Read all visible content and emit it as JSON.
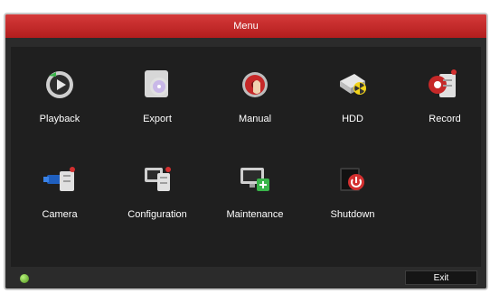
{
  "window": {
    "title": "Menu"
  },
  "menu": {
    "items": [
      {
        "label": "Playback",
        "icon": "playback-icon"
      },
      {
        "label": "Export",
        "icon": "export-icon"
      },
      {
        "label": "Manual",
        "icon": "manual-icon"
      },
      {
        "label": "HDD",
        "icon": "hdd-icon"
      },
      {
        "label": "Record",
        "icon": "record-icon"
      },
      {
        "label": "Camera",
        "icon": "camera-icon"
      },
      {
        "label": "Configuration",
        "icon": "configuration-icon"
      },
      {
        "label": "Maintenance",
        "icon": "maintenance-icon"
      },
      {
        "label": "Shutdown",
        "icon": "shutdown-icon"
      }
    ]
  },
  "footer": {
    "exit_label": "Exit",
    "status_icon": "status-indicator-icon"
  },
  "colors": {
    "title_bar": "#c62828",
    "background": "#1f1f1f",
    "accent_red": "#d32f2f"
  }
}
